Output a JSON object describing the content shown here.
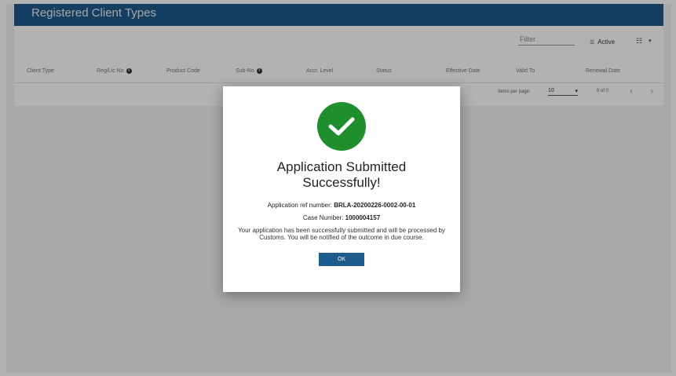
{
  "header": {
    "title": "Registered Client Types"
  },
  "toolbar": {
    "filter_placeholder": "Filter",
    "active_label": "Active",
    "active_icon": "filter-icon",
    "columns_icon": "columns-icon"
  },
  "table": {
    "columns": [
      {
        "label": "Client Type"
      },
      {
        "label": "Reg/Lic No",
        "info": true
      },
      {
        "label": "Product Code"
      },
      {
        "label": "Sub-No",
        "info": true
      },
      {
        "label": "Accr. Level"
      },
      {
        "label": "Status"
      },
      {
        "label": "Effective Date"
      },
      {
        "label": "Valid To"
      },
      {
        "label": "Renewal Date"
      }
    ],
    "rows": []
  },
  "paginator": {
    "items_per_page_label": "Items per page:",
    "page_size": "10",
    "range_label": "0 of 0",
    "prev_icon": "chevron-left-icon",
    "next_icon": "chevron-right-icon"
  },
  "dialog": {
    "icon": "check-icon",
    "title": "Application Submitted Successfully!",
    "ref_label": "Application ref number:",
    "ref_value": "BRLA-20200226-0002-00-01",
    "case_label": "Case Number:",
    "case_value": "1000004157",
    "message": "Your application has been successfully submitted and will be processed by Customs. You will be notified of the outcome in due course.",
    "ok_label": "OK"
  },
  "colors": {
    "primary": "#1d5b8c",
    "success": "#1f8f2e",
    "overlay": "rgba(0,0,0,0.30)"
  }
}
